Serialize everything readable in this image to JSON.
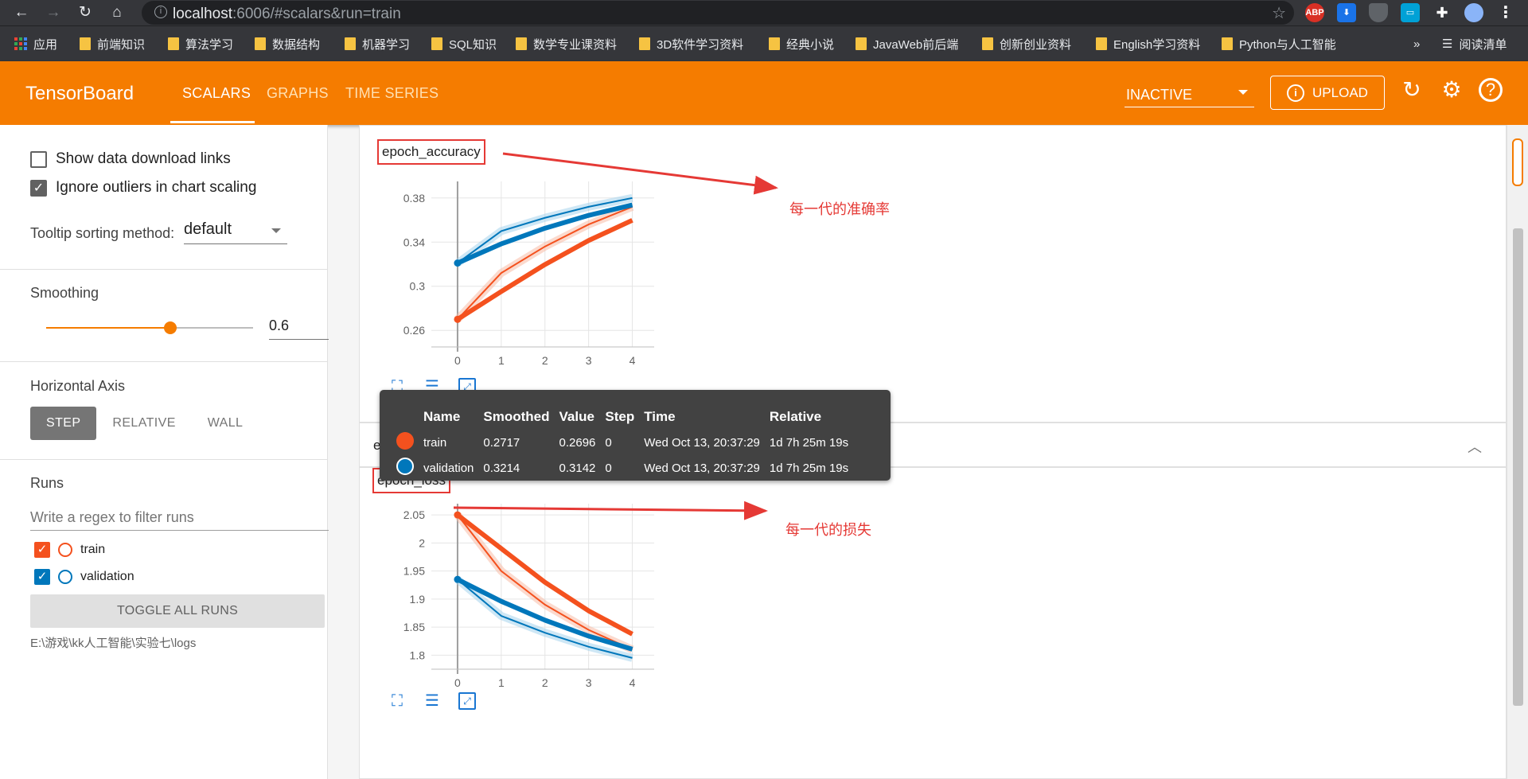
{
  "browser": {
    "url_host": "localhost",
    "url_rest": ":6006/#scalars&run=train",
    "bookmarks": [
      {
        "label": "应用",
        "type": "apps"
      },
      {
        "label": "前端知识"
      },
      {
        "label": "算法学习"
      },
      {
        "label": "数据结构"
      },
      {
        "label": "机器学习"
      },
      {
        "label": "SQL知识"
      },
      {
        "label": "数学专业课资料"
      },
      {
        "label": "3D软件学习资料"
      },
      {
        "label": "经典小说"
      },
      {
        "label": "JavaWeb前后端"
      },
      {
        "label": "创新创业资料"
      },
      {
        "label": "English学习资料"
      },
      {
        "label": "Python与人工智能"
      }
    ],
    "overflow_label": "»",
    "reading_list_label": "阅读清单",
    "extensions": [
      "ABP"
    ]
  },
  "header": {
    "logo": "TensorBoard",
    "tabs": [
      {
        "label": "SCALARS",
        "active": true
      },
      {
        "label": "GRAPHS",
        "active": false
      },
      {
        "label": "TIME SERIES",
        "active": false
      }
    ],
    "run_select": "INACTIVE",
    "upload_label": "UPLOAD",
    "colors": {
      "header_bg": "#f57c00"
    }
  },
  "sidebar": {
    "show_download_links": {
      "label": "Show data download links",
      "checked": false
    },
    "ignore_outliers": {
      "label": "Ignore outliers in chart scaling",
      "checked": true
    },
    "tooltip_sorting": {
      "label": "Tooltip sorting method:",
      "value": "default"
    },
    "smoothing": {
      "label": "Smoothing",
      "value": "0.6",
      "fraction": 0.6
    },
    "horizontal_axis": {
      "label": "Horizontal Axis",
      "options": [
        "STEP",
        "RELATIVE",
        "WALL"
      ],
      "active": "STEP"
    },
    "runs": {
      "label": "Runs",
      "filter_placeholder": "Write a regex to filter runs",
      "items": [
        {
          "name": "train",
          "checked": true,
          "color": "#f4511e"
        },
        {
          "name": "validation",
          "checked": true,
          "color": "#0077bb"
        }
      ],
      "toggle_label": "TOGGLE ALL RUNS",
      "logdir": "E:\\游戏\\kk人工智能\\实验七\\logs"
    }
  },
  "cards": [
    {
      "title": "epoch_accuracy",
      "annotation": "每一代的准确率",
      "group_header": "epoch_loss"
    },
    {
      "title": "epoch_loss",
      "annotation": "每一代的损失"
    }
  ],
  "tooltip": {
    "headers": [
      "Name",
      "Smoothed",
      "Value",
      "Step",
      "Time",
      "Relative"
    ],
    "rows": [
      {
        "name": "train",
        "smoothed": "0.2717",
        "value": "0.2696",
        "step": "0",
        "time": "Wed Oct 13, 20:37:29",
        "relative": "1d 7h 25m 19s",
        "color": "#f4511e"
      },
      {
        "name": "validation",
        "smoothed": "0.3214",
        "value": "0.3142",
        "step": "0",
        "time": "Wed Oct 13, 20:37:29",
        "relative": "1d 7h 25m 19s",
        "color": "#0077bb"
      }
    ]
  },
  "chart_data": [
    {
      "type": "line",
      "title": "epoch_accuracy",
      "x": [
        0,
        1,
        2,
        3,
        4
      ],
      "xticks": [
        "0",
        "1",
        "2",
        "3",
        "4"
      ],
      "yticks": [
        "0.26",
        "0.3",
        "0.34",
        "0.38"
      ],
      "ylim": [
        0.245,
        0.395
      ],
      "series": [
        {
          "name": "train",
          "color": "#f4511e",
          "values": [
            0.27,
            0.312,
            0.336,
            0.356,
            0.372
          ]
        },
        {
          "name": "validation",
          "color": "#0077bb",
          "values": [
            0.321,
            0.35,
            0.362,
            0.372,
            0.38
          ]
        }
      ]
    },
    {
      "type": "line",
      "title": "epoch_loss",
      "x": [
        0,
        1,
        2,
        3,
        4
      ],
      "xticks": [
        "0",
        "1",
        "2",
        "3",
        "4"
      ],
      "yticks": [
        "1.8",
        "1.85",
        "1.9",
        "1.95",
        "2",
        "2.05"
      ],
      "ylim": [
        1.775,
        2.07
      ],
      "series": [
        {
          "name": "train",
          "color": "#f4511e",
          "values": [
            2.05,
            1.95,
            1.89,
            1.845,
            1.81
          ]
        },
        {
          "name": "validation",
          "color": "#0077bb",
          "values": [
            1.935,
            1.87,
            1.84,
            1.815,
            1.795
          ]
        }
      ]
    }
  ]
}
